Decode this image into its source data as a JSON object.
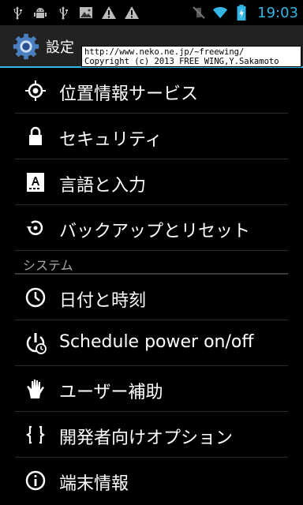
{
  "status_bar": {
    "left_icons": [
      "usb-icon",
      "android-debug-icon",
      "usb-icon",
      "image-icon",
      "warning-icon",
      "warning-icon"
    ],
    "right_icons": [
      "mute-icon",
      "wifi-icon",
      "battery-charging-icon"
    ],
    "time": "19:03",
    "accent_color": "#33b5e5"
  },
  "action_bar": {
    "title": "設定",
    "icon": "settings-gear-icon"
  },
  "watermark": {
    "line1": "http://www.neko.ne.jp/~freewing/",
    "line2": "Copyright (c) 2013 FREE WING,Y.Sakamoto"
  },
  "items": [
    {
      "label": "位置情報サービス",
      "icon": "location-icon"
    },
    {
      "label": "セキュリティ",
      "icon": "lock-icon"
    },
    {
      "label": "言語と入力",
      "icon": "keyboard-language-icon"
    },
    {
      "label": "バックアップとリセット",
      "icon": "backup-reset-icon"
    }
  ],
  "section_system": {
    "label": "システム"
  },
  "system_items": [
    {
      "label": "日付と時刻",
      "icon": "clock-icon"
    },
    {
      "label": "Schedule power on/off",
      "icon": "power-schedule-icon"
    },
    {
      "label": "ユーザー補助",
      "icon": "accessibility-hand-icon"
    },
    {
      "label": "開発者向けオプション",
      "icon": "developer-braces-icon"
    },
    {
      "label": "端末情報",
      "icon": "info-icon"
    }
  ]
}
